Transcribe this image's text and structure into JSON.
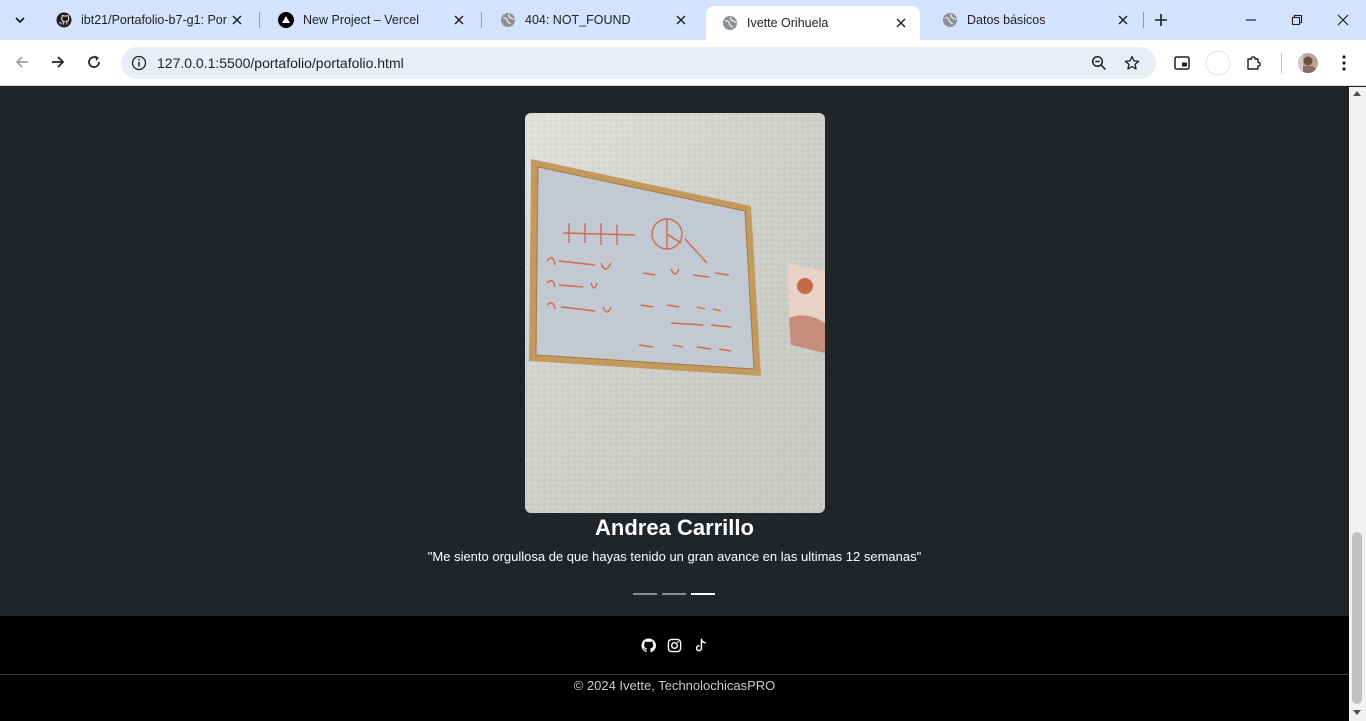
{
  "browser": {
    "tabs": [
      {
        "title": "ibt21/Portafolio-b7-g1: Porta",
        "icon": "github-icon",
        "active": false
      },
      {
        "title": "New Project – Vercel",
        "icon": "vercel-icon",
        "active": false
      },
      {
        "title": "404: NOT_FOUND",
        "icon": "globe-icon",
        "active": false
      },
      {
        "title": "Ivette Orihuela",
        "icon": "globe-icon",
        "active": true
      },
      {
        "title": "Datos básicos",
        "icon": "globe-icon",
        "active": false
      }
    ],
    "url": "127.0.0.1:5500/portafolio/portafolio.html",
    "colors": {
      "tabstrip": "#d3e3fd",
      "omnibox": "#e9eef6"
    }
  },
  "testimonial": {
    "name": "Andrea Carrillo",
    "quote": "\"Me siento orgullosa de que hayas tenido un gran avance en las ultimas 12 semanas\"",
    "slide_count": 3,
    "active_slide": 3
  },
  "footer": {
    "social_icons": [
      "github-icon",
      "instagram-icon",
      "tiktok-icon"
    ],
    "copyright": "© 2024 Ivette, TechnolochicasPRO"
  },
  "theme": {
    "page_bg": "#212529",
    "footer_bg": "#000000",
    "text": "#ffffff"
  }
}
